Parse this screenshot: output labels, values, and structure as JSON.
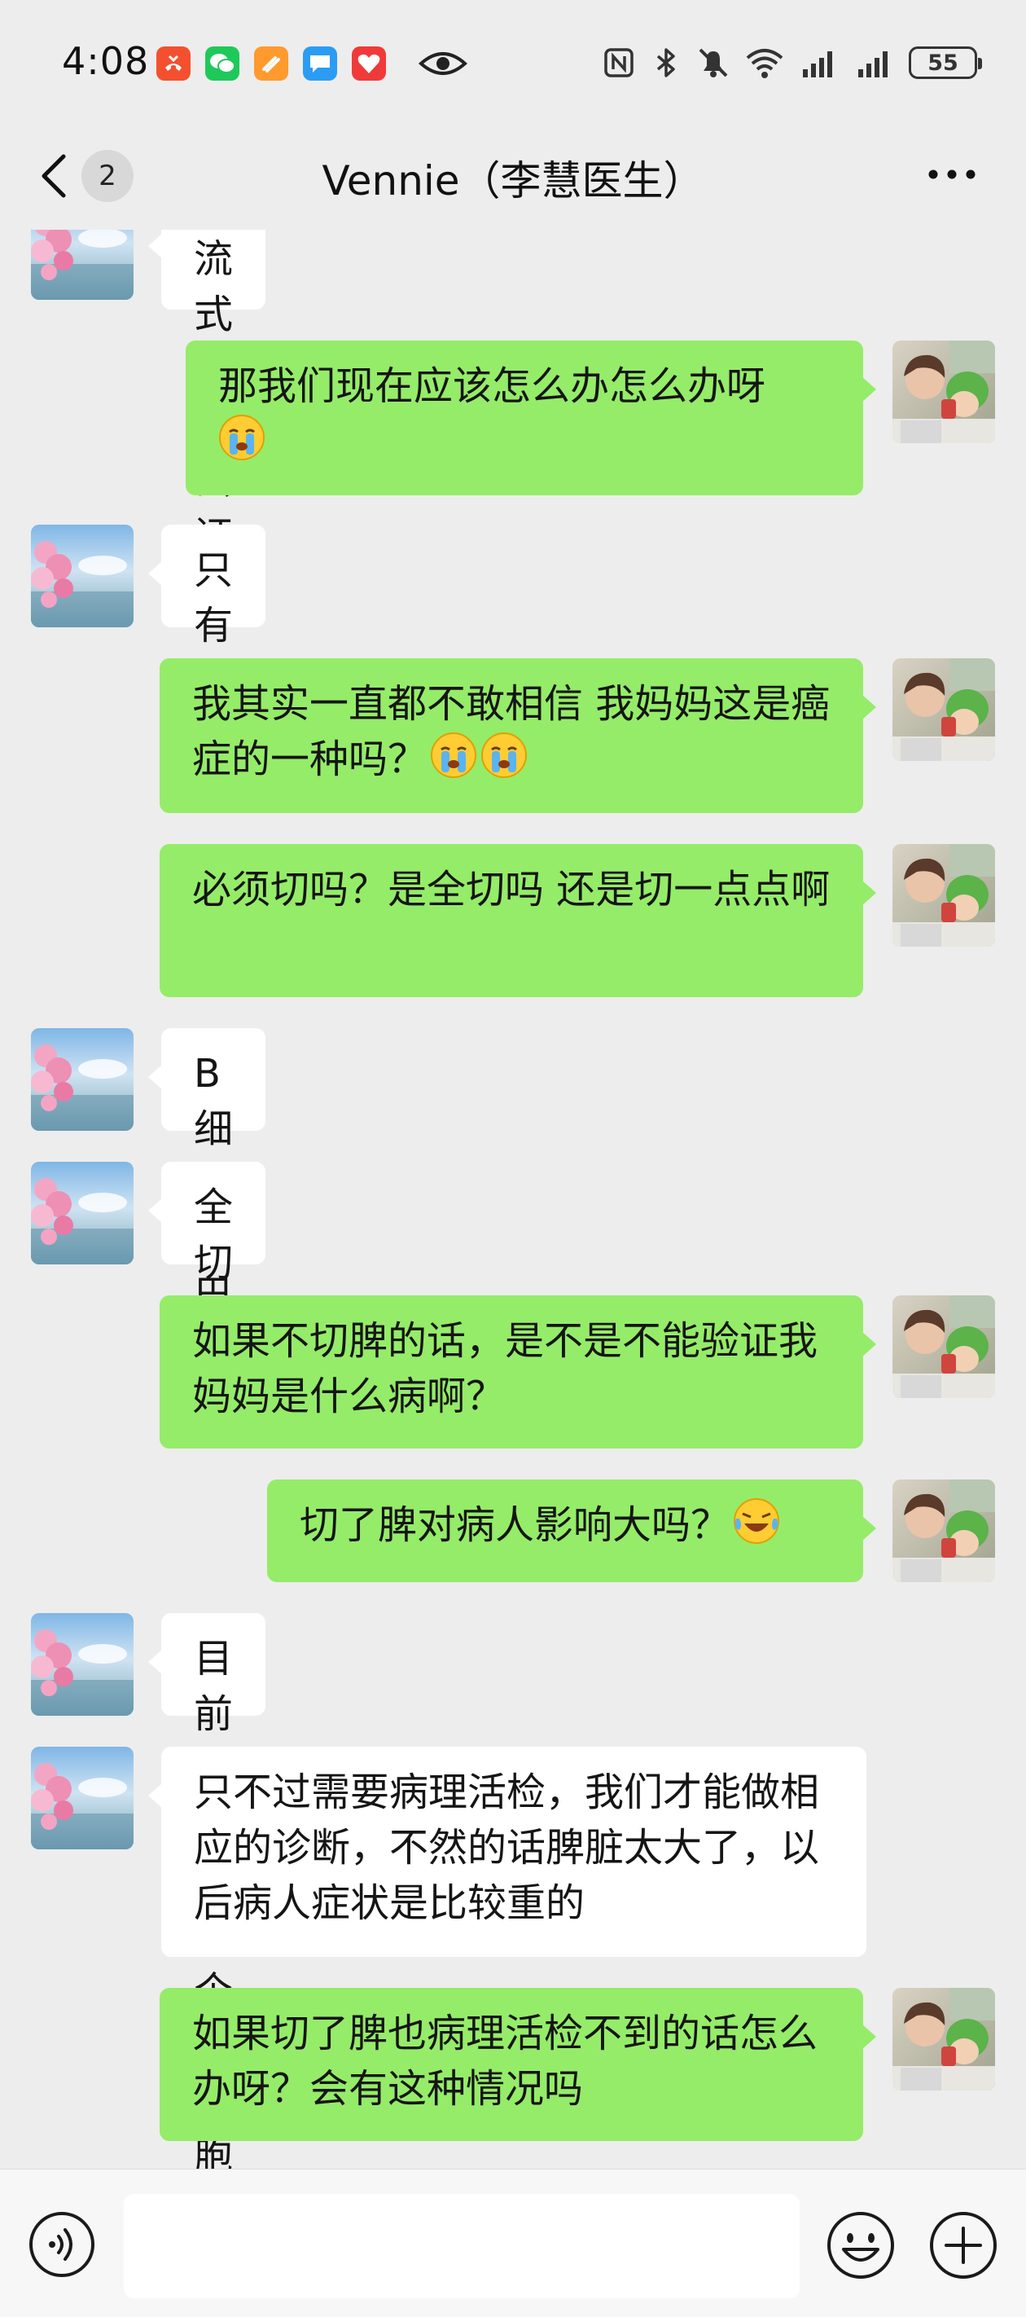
{
  "status_bar": {
    "time": "4:08",
    "battery": "55",
    "apps": [
      {
        "name": "missed-call-app",
        "color": "#f4502f"
      },
      {
        "name": "wechat-app",
        "color": "#1ec95a"
      },
      {
        "name": "taobao-app",
        "color": "#ff9a2e"
      },
      {
        "name": "message-app",
        "color": "#2b9cf4"
      },
      {
        "name": "health-app",
        "color": "#f03a3a"
      }
    ]
  },
  "header": {
    "back_count": "2",
    "title": "Vennie（李慧医生）"
  },
  "colors": {
    "my_bubble": "#95ec69",
    "their_bubble": "#ffffff",
    "background": "#ededed"
  },
  "messages": [
    {
      "side": "left",
      "text": "流式能够去证明"
    },
    {
      "side": "right",
      "text": "那我们现在应该怎么办怎么办呀",
      "emoji": [
        "crying-emoji"
      ]
    },
    {
      "side": "left",
      "text": "只有切脾"
    },
    {
      "side": "right",
      "text": "我其实一直都不敢相信 我妈妈这是癌症的一种吗？",
      "emoji": [
        "crying-emoji",
        "crying-emoji"
      ]
    },
    {
      "side": "right",
      "text": "必须切吗？是全切吗 还是切一点点啊"
    },
    {
      "side": "left",
      "text": "B 细胞淋巴瘤"
    },
    {
      "side": "left",
      "text": "全切"
    },
    {
      "side": "right",
      "text": "如果不切脾的话，是不是不能验证我妈妈是什么病啊？"
    },
    {
      "side": "right",
      "text": "切了脾对病人影响大吗？",
      "emoji": [
        "laugh-cry-emoji"
      ]
    },
    {
      "side": "left",
      "text": "目前肯定是一个 b 细胞淋巴瘤"
    },
    {
      "side": "left",
      "text": "只不过需要病理活检，我们才能做相应的诊断，不然的话脾脏太大了，以后病人症状是比较重的"
    },
    {
      "side": "right",
      "text": "如果切了脾也病理活检不到的话怎么办呀？会有这种情况吗"
    }
  ],
  "input": {
    "value": "",
    "placeholder": ""
  }
}
